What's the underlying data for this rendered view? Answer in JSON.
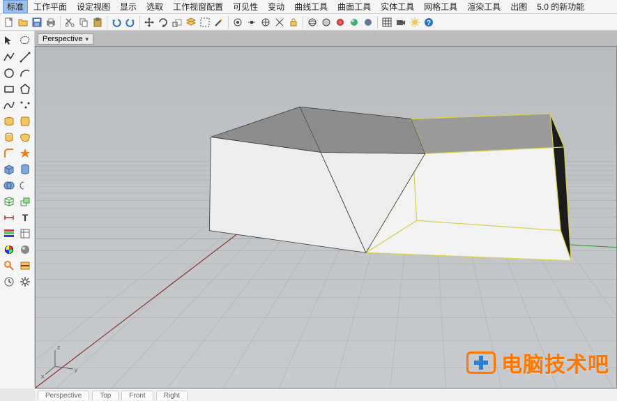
{
  "menu": {
    "items": [
      "标准",
      "工作平面",
      "设定视图",
      "显示",
      "选取",
      "工作视窗配置",
      "可见性",
      "变动",
      "曲线工具",
      "曲面工具",
      "实体工具",
      "网格工具",
      "渲染工具",
      "出图",
      "5.0 的新功能"
    ],
    "active_index": 0
  },
  "toolbar": {
    "icons": [
      "new",
      "open",
      "save",
      "print",
      "separator",
      "copy",
      "paste",
      "separator",
      "undo",
      "redo",
      "separator",
      "move",
      "rotate",
      "scale",
      "mirror",
      "separator",
      "layer-up",
      "layer-down",
      "separator",
      "box-select",
      "wand",
      "separator",
      "osnap-end",
      "osnap-mid",
      "osnap-center",
      "osnap-int",
      "osnap-perp",
      "osnap-tan",
      "osnap-quad",
      "separator",
      "shade-wire",
      "shade-ghost",
      "shade-render",
      "shade-solid",
      "separator",
      "render",
      "lights",
      "camera",
      "help"
    ]
  },
  "viewport": {
    "label": "Perspective",
    "axes": {
      "x": "x",
      "y": "y",
      "z": "z"
    }
  },
  "left_tools": [
    [
      "pointer",
      "lasso"
    ],
    [
      "polyline",
      "line"
    ],
    [
      "circle",
      "arc"
    ],
    [
      "rect",
      "polygon"
    ],
    [
      "curve",
      "free-curve"
    ],
    [
      "text",
      "dim"
    ],
    [
      "surf-loft",
      "surf-sweep"
    ],
    [
      "surf-rev",
      "surf-patch"
    ],
    [
      "fillet",
      "blend"
    ],
    [
      "box",
      "sphere"
    ],
    [
      "cylinder",
      "cone"
    ],
    [
      "bool-union",
      "bool-diff"
    ],
    [
      "mesh",
      "mesh-edit"
    ],
    [
      "array",
      "mirror"
    ],
    [
      "layer-panel",
      "props"
    ],
    [
      "color",
      "material"
    ],
    [
      "analyze",
      "section"
    ]
  ],
  "bottom_tabs": [
    "Perspective",
    "Top",
    "Front",
    "Right"
  ],
  "watermark": {
    "text": "电脑技术吧"
  },
  "colors": {
    "selection": "#d8d050",
    "axis_x": "#a03030",
    "axis_y": "#3c9a3c",
    "grid_minor": "#a8acaf",
    "grid_major": "#98999a"
  },
  "scene": {
    "objects": [
      {
        "type": "box",
        "selected": false,
        "position": "left"
      },
      {
        "type": "box-wire",
        "selected": true,
        "position": "right"
      }
    ]
  }
}
